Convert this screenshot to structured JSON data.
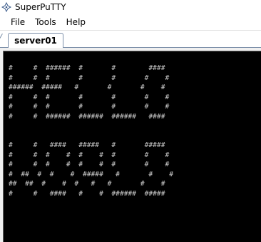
{
  "window": {
    "title": "SuperPuTTY"
  },
  "menu": {
    "items": [
      "File",
      "Tools",
      "Help"
    ]
  },
  "tabs": [
    {
      "label": "server01",
      "active": true
    }
  ],
  "terminal": {
    "background": "#000000",
    "foreground": "#c8c8c8",
    "lines": [
      "#     #  ######  #       #        ####",
      "#     #  #       #       #       #    #",
      "######  #####   #       #       #    #",
      "#     #  #       #       #       #    #",
      "#     #  #       #       #       #    #",
      "#     #  ######  ######  ######   ####",
      "",
      "",
      "#     #   ####   #####   #       #####",
      "#     #  #    #  #    #  #       #    #",
      "#     #  #    #  #    #  #       #    #",
      "#  ##  #  #    #  #####   #       #    #",
      "##  ##  #    #  #   #   #       #    #",
      "#     #   ####   #    #  ######  #####"
    ]
  },
  "icons": {
    "app": "superputty-icon"
  }
}
